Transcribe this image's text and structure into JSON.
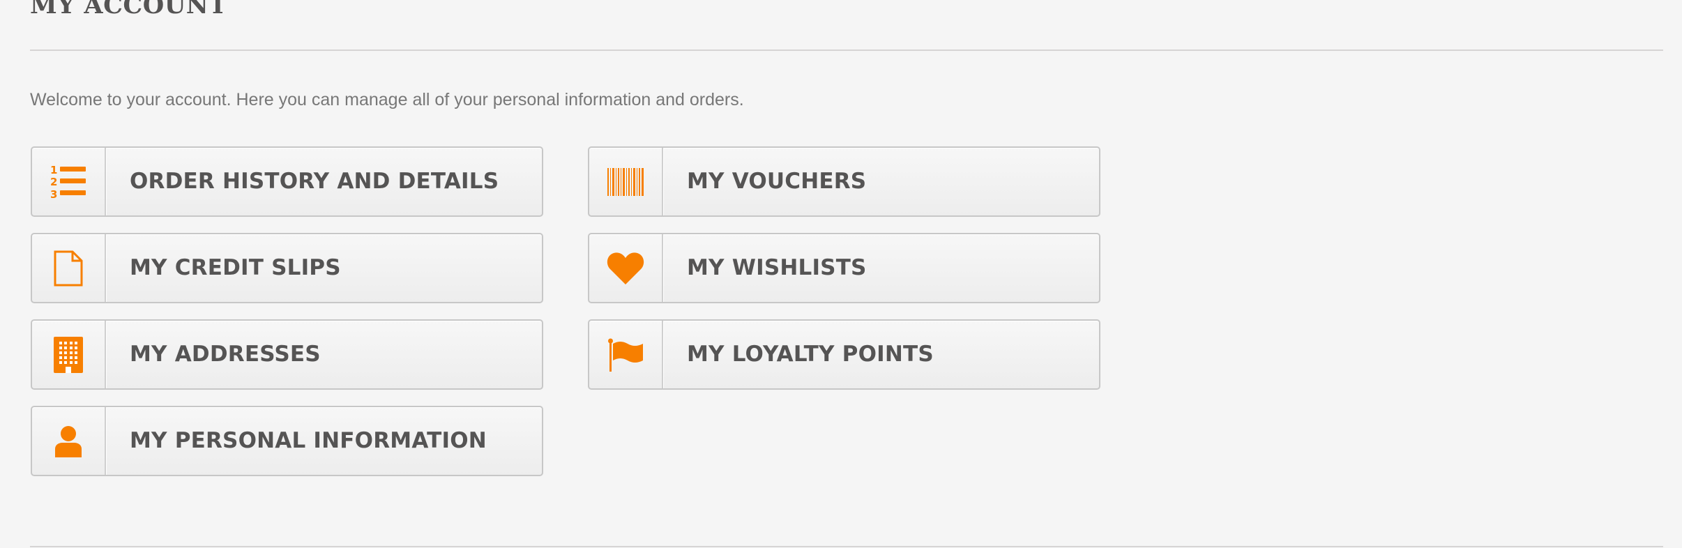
{
  "page": {
    "title": "MY ACCOUNT",
    "welcome_text": "Welcome to your account. Here you can manage all of your personal information and orders."
  },
  "theme": {
    "accent_color": "#f77f00",
    "text_color": "#555454",
    "background": "#f5f5f5"
  },
  "account_links": {
    "left_column": [
      {
        "label": "ORDER HISTORY AND DETAILS",
        "icon": "ordered-list-icon"
      },
      {
        "label": "MY CREDIT SLIPS",
        "icon": "document-icon"
      },
      {
        "label": "MY ADDRESSES",
        "icon": "building-icon"
      },
      {
        "label": "MY PERSONAL INFORMATION",
        "icon": "user-icon"
      }
    ],
    "right_column": [
      {
        "label": "MY VOUCHERS",
        "icon": "barcode-icon"
      },
      {
        "label": "MY WISHLISTS",
        "icon": "heart-icon"
      },
      {
        "label": "MY LOYALTY POINTS",
        "icon": "flag-icon"
      }
    ]
  }
}
